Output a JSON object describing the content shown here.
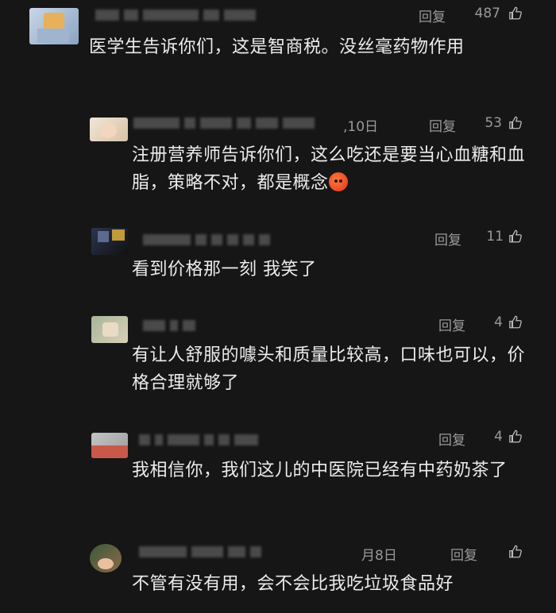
{
  "ui": {
    "reply_label": "回复"
  },
  "comments": [
    {
      "likes": "487",
      "text": "医学生告诉你们，这是智商税。没丝毫药物作用"
    },
    {
      "date": ",10日",
      "likes": "53",
      "text": "注册营养师告诉你们，这么吃还是要当心血糖和血脂，策略不对，都是概念",
      "emoji": "hot-face-emoji"
    },
    {
      "likes": "11",
      "text": "看到价格那一刻 我笑了"
    },
    {
      "likes": "4",
      "text": "有让人舒服的噱头和质量比较高，口味也可以，价格合理就够了"
    },
    {
      "likes": "4",
      "text": "我相信你，我们这儿的中医院已经有中药奶茶了"
    },
    {
      "date": "月8日",
      "likes": "",
      "text": "不管有没有用，会不会比我吃垃圾食品好"
    }
  ],
  "icons": {
    "like": "thumbs-up-icon"
  }
}
